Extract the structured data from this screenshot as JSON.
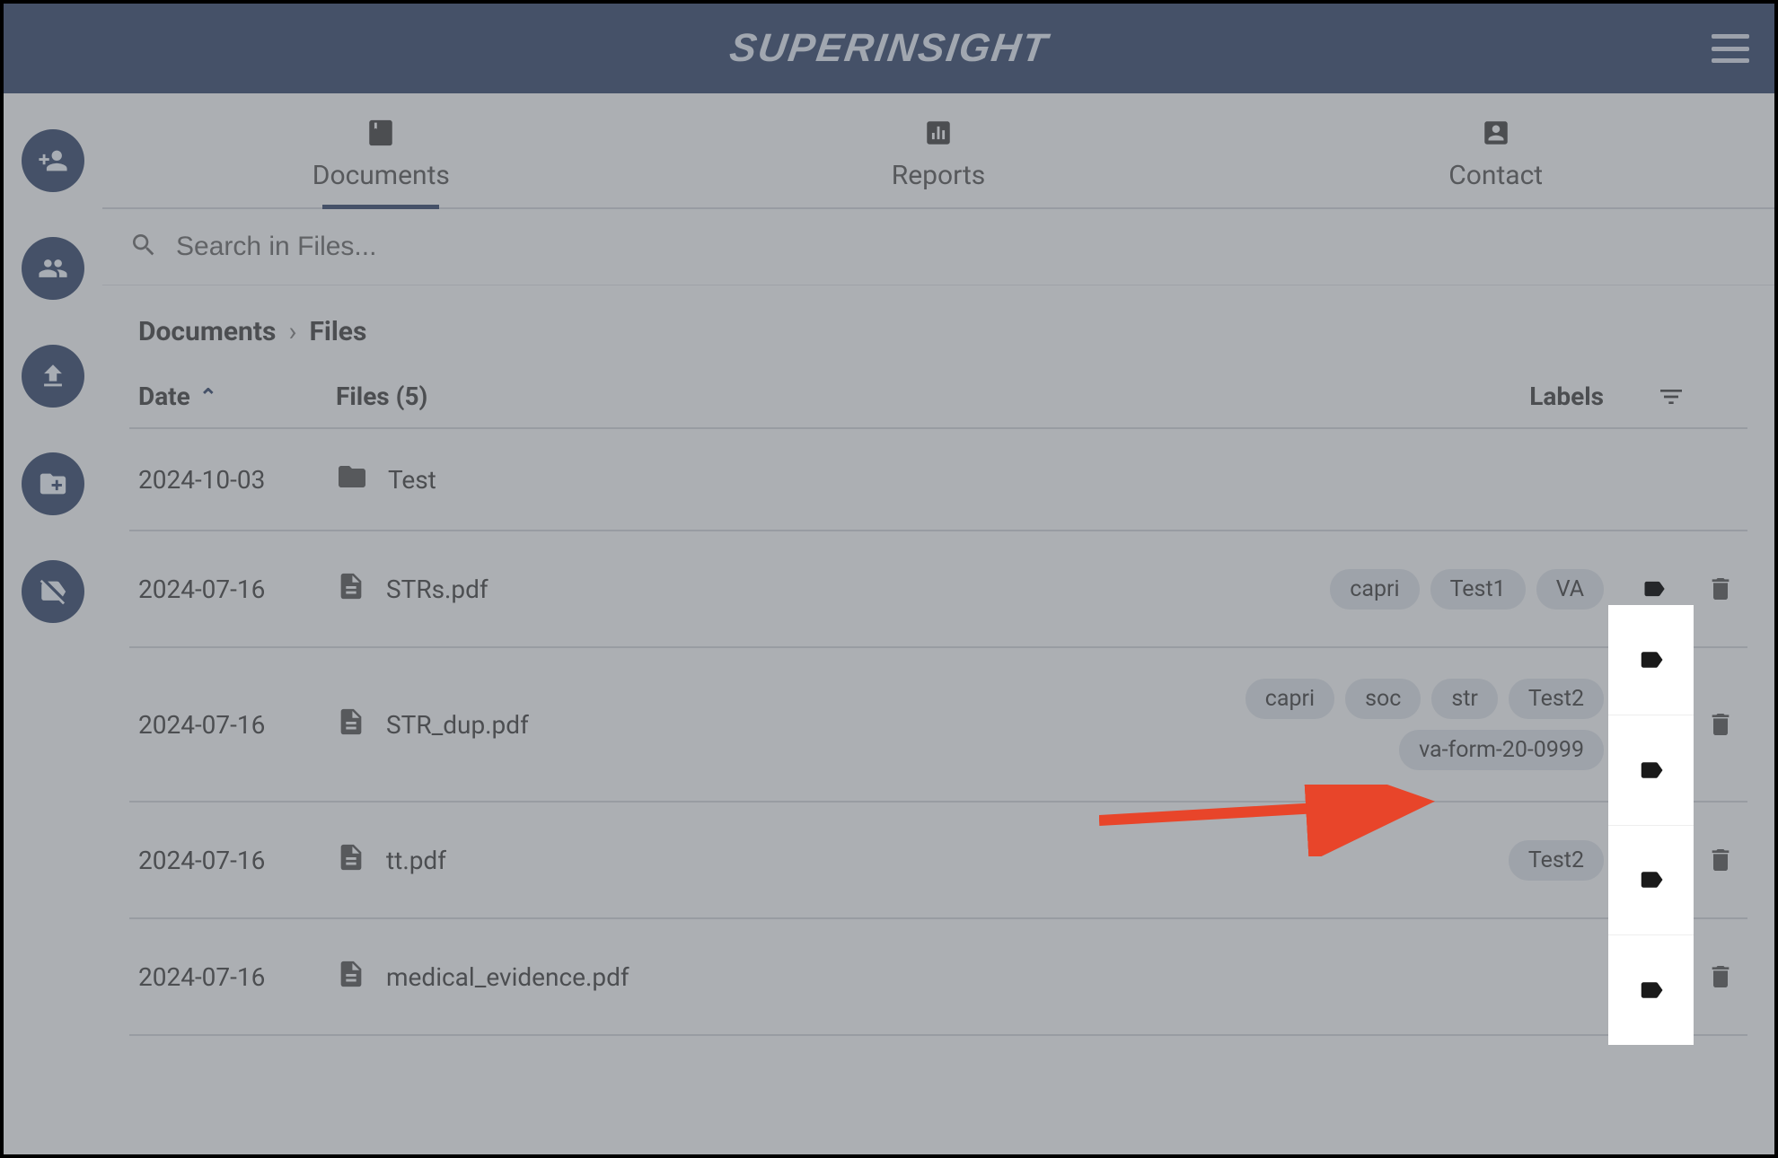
{
  "brand": "SUPERINSIGHT",
  "tabs": [
    {
      "label": "Documents",
      "active": true
    },
    {
      "label": "Reports",
      "active": false
    },
    {
      "label": "Contact",
      "active": false
    }
  ],
  "search": {
    "placeholder": "Search in Files..."
  },
  "breadcrumb": {
    "root": "Documents",
    "leaf": "Files"
  },
  "columns": {
    "date": "Date",
    "files": "Files (5)",
    "labels": "Labels"
  },
  "rows": [
    {
      "date": "2024-10-03",
      "kind": "folder",
      "name": "Test",
      "labels": [],
      "has_actions": false
    },
    {
      "date": "2024-07-16",
      "kind": "file",
      "name": "STRs.pdf",
      "labels": [
        "capri",
        "Test1",
        "VA"
      ],
      "has_actions": true
    },
    {
      "date": "2024-07-16",
      "kind": "file",
      "name": "STR_dup.pdf",
      "labels": [
        "capri",
        "soc",
        "str",
        "Test2",
        "va-form-20-0999"
      ],
      "has_actions": true
    },
    {
      "date": "2024-07-16",
      "kind": "file",
      "name": "tt.pdf",
      "labels": [
        "Test2"
      ],
      "has_actions": true
    },
    {
      "date": "2024-07-16",
      "kind": "file",
      "name": "medical_evidence.pdf",
      "labels": [],
      "has_actions": true
    }
  ]
}
